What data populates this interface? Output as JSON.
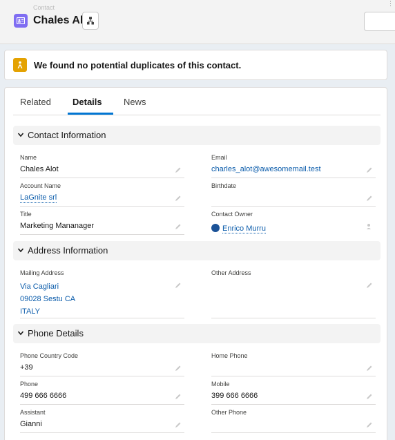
{
  "header": {
    "object_label": "Contact",
    "record_name": "Chales Alot"
  },
  "duplicate_banner": {
    "text": "We found no potential duplicates of this contact."
  },
  "tabs": [
    {
      "label": "Related"
    },
    {
      "label": "Details"
    },
    {
      "label": "News"
    }
  ],
  "sections": {
    "contact": "Contact Information",
    "address": "Address Information",
    "phone": "Phone Details"
  },
  "fields": {
    "name": {
      "label": "Name",
      "value": "Chales Alot"
    },
    "email": {
      "label": "Email",
      "value": "charles_alot@awesomemail.test"
    },
    "account_name": {
      "label": "Account Name",
      "value": "LaGnite srl"
    },
    "birthdate": {
      "label": "Birthdate",
      "value": ""
    },
    "title": {
      "label": "Title",
      "value": "Marketing Mananager"
    },
    "contact_owner": {
      "label": "Contact Owner",
      "value": "Enrico Murru"
    },
    "mailing_address": {
      "label": "Mailing Address",
      "lines": [
        "Via Cagliari",
        "09028 Sestu CA",
        "ITALY"
      ]
    },
    "other_address": {
      "label": "Other Address",
      "value": ""
    },
    "phone_country_code": {
      "label": "Phone Country Code",
      "value": "+39"
    },
    "home_phone": {
      "label": "Home Phone",
      "value": ""
    },
    "phone": {
      "label": "Phone",
      "value": "499 666 6666"
    },
    "mobile": {
      "label": "Mobile",
      "value": "399 666 6666"
    },
    "assistant": {
      "label": "Assistant",
      "value": "Gianni"
    },
    "other_phone": {
      "label": "Other Phone",
      "value": ""
    }
  },
  "colors": {
    "contact_icon": "#7f6df2",
    "warning_icon": "#e4a201",
    "link": "#0b5cab",
    "tab_active": "#0176d3"
  }
}
